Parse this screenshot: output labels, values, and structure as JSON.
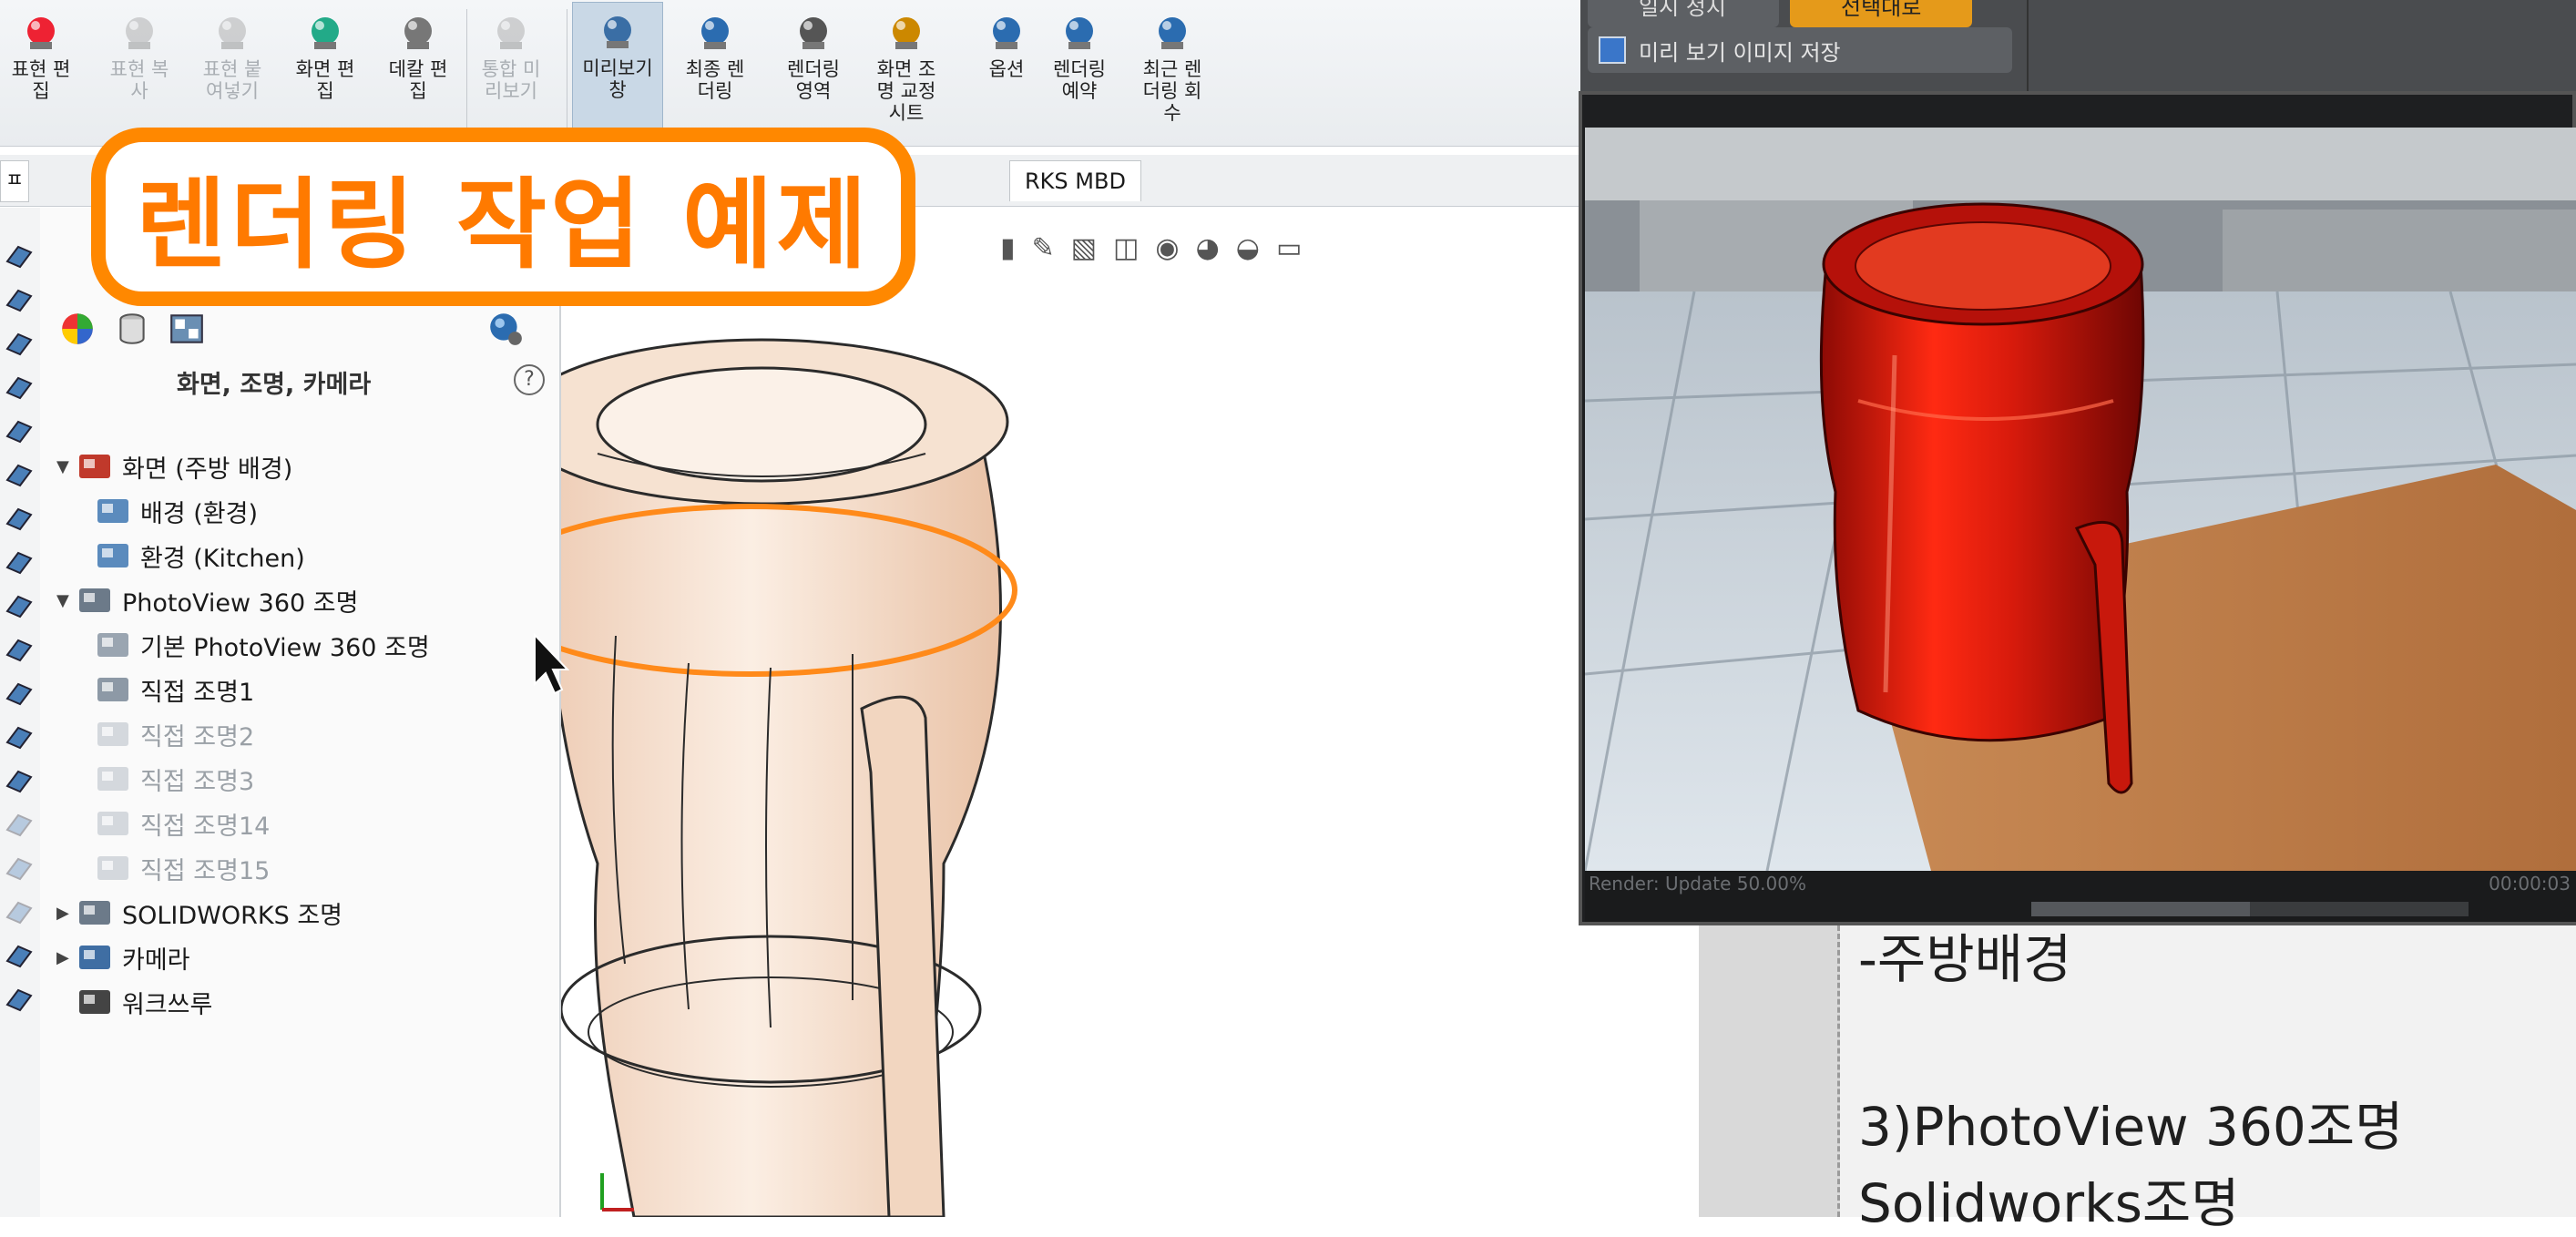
{
  "ribbon": {
    "buttons": [
      {
        "label": "표현 편\n집",
        "state": "normal"
      },
      {
        "label": "표현 복\n사",
        "state": "dim"
      },
      {
        "label": "표현 붙\n여넣기",
        "state": "dim"
      },
      {
        "label": "화면 편\n집",
        "state": "normal"
      },
      {
        "label": "데칼 편\n집",
        "state": "normal"
      },
      {
        "label": "통합 미\n리보기",
        "state": "dim"
      },
      {
        "label": "미리보기\n창",
        "state": "active"
      },
      {
        "label": "최종 렌\n더링",
        "state": "normal"
      },
      {
        "label": "렌더링\n영역",
        "state": "normal"
      },
      {
        "label": "화면 조\n명 교정\n시트",
        "state": "normal"
      },
      {
        "label": "옵션",
        "state": "normal"
      },
      {
        "label": "렌더링\n예약",
        "state": "normal"
      },
      {
        "label": "최근 렌\n더링 회\n수",
        "state": "normal"
      }
    ]
  },
  "tabs": {
    "left_tab": "ㅍ",
    "mbd_tab": "RKS MBD"
  },
  "banner": {
    "title": "렌더링 작업 예제"
  },
  "panel": {
    "title": "화면, 조명, 카메라",
    "help": "?",
    "tree": [
      {
        "label": "화면 (주방 배경)",
        "level": 0,
        "arrow": "▼",
        "icon": "scene-icon",
        "dim": false
      },
      {
        "label": "배경 (환경)",
        "level": 1,
        "arrow": "",
        "icon": "background-icon",
        "dim": false
      },
      {
        "label": "환경 (Kitchen)",
        "level": 1,
        "arrow": "",
        "icon": "environment-icon",
        "dim": false
      },
      {
        "label": "PhotoView 360 조명",
        "level": 0,
        "arrow": "▼",
        "icon": "lights-folder-icon",
        "dim": false
      },
      {
        "label": "기본 PhotoView 360 조명",
        "level": 1,
        "arrow": "",
        "icon": "default-light-icon",
        "dim": false
      },
      {
        "label": "직접 조명1",
        "level": 1,
        "arrow": "",
        "icon": "directional-light-icon",
        "dim": false
      },
      {
        "label": "직접 조명2",
        "level": 1,
        "arrow": "",
        "icon": "directional-light-icon",
        "dim": true
      },
      {
        "label": "직접 조명3",
        "level": 1,
        "arrow": "",
        "icon": "directional-light-icon",
        "dim": true
      },
      {
        "label": "직접 조명14",
        "level": 1,
        "arrow": "",
        "icon": "directional-light-icon",
        "dim": true
      },
      {
        "label": "직접 조명15",
        "level": 1,
        "arrow": "",
        "icon": "directional-light-icon",
        "dim": true
      },
      {
        "label": "SOLIDWORKS 조명",
        "level": 0,
        "arrow": "▶",
        "icon": "lights-folder-icon",
        "dim": false
      },
      {
        "label": "카메라",
        "level": 0,
        "arrow": "▶",
        "icon": "camera-folder-icon",
        "dim": false
      },
      {
        "label": "워크쓰루",
        "level": 0,
        "arrow": "",
        "icon": "walkthrough-icon",
        "dim": false
      }
    ]
  },
  "render": {
    "save_label": "미리 보기 이미지 저장",
    "status_left": "Render: Update 50.00%",
    "status_right": "00:00:03",
    "progress": 0.5,
    "top_left_label": "일시 정지",
    "top_mid_label": "선택대로"
  },
  "notes": {
    "line1": "-주방배경",
    "line2": "3)PhotoView 360조명",
    "line3": "  Solidworks조명"
  },
  "colors": {
    "accent": "#ff8800",
    "active_tab": "#c9d8e6",
    "mug_body": "#f3d9c4",
    "render_mug": "#d61a0c"
  }
}
